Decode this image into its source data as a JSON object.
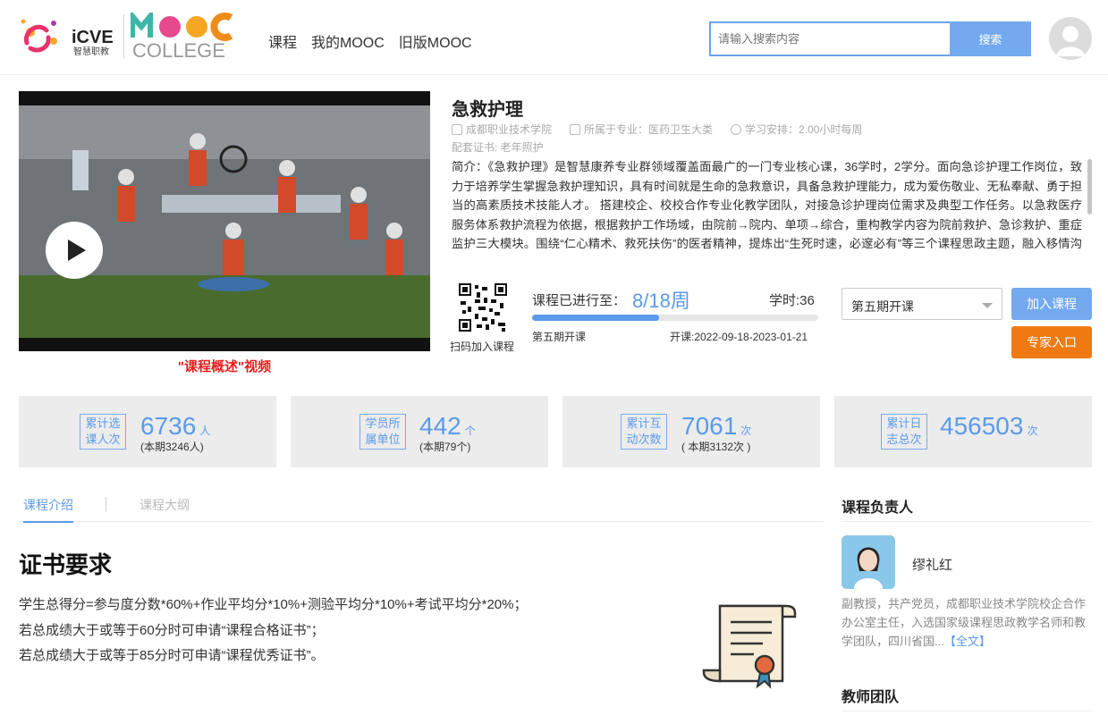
{
  "header": {
    "logo_icve_text": "iCVE",
    "logo_icve_sub": "智慧职教",
    "logo_mooc_text": "MOOC",
    "logo_college_text": "COLLEGE",
    "nav": [
      "课程",
      "我的MOOC",
      "旧版MOOC"
    ],
    "search_placeholder": "请输入搜索内容",
    "search_button": "搜索"
  },
  "video": {
    "caption": "\"课程概述\"视频"
  },
  "course": {
    "title": "急救护理",
    "school": "成都职业技术学院",
    "major": "所属于专业：医药卫生大类",
    "schedule": "学习安排：2.00小时每周",
    "certificate": "配套证书: 老年照护",
    "intro": "简介：《急救护理》是智慧康养专业群领域覆盖面最广的一门专业核心课，36学时，2学分。面向急诊护理工作岗位，致力于培养学生掌握急救护理知识，具有时间就是生命的急救意识，具备急救护理能力，成为爱伤敬业、无私奉献、勇于担当的高素质技术技能人才。 搭建校企、校校合作专业化教学团队，对接急诊护理岗位需求及典型工作任务。以急救医疗服务体系救护流程为依据，根据救护工作场域，由院前→院内、单项→综合，重构教学内容为院前救护、急诊救护、重症监护三大模块。围绕“仁心精术、救死扶伤”的医者精神，提炼出“生死时速，必邃必有”等三个课程思政主题，融入移情沟通、爱伤敬业等思政元素，通过线上线下、课内课外结合，将思政元素基因式融入。"
  },
  "progress": {
    "qr_label": "扫码加入课程",
    "label": "课程已进行至：",
    "value": "8/18周",
    "fraction": 0.444,
    "hours": "学时:36",
    "term": "第五期开课",
    "dates": "开课:2022-09-18-2023-01-21"
  },
  "actions": {
    "term_select": "第五期开课",
    "join": "加入课程",
    "expert": "专家入口"
  },
  "stats": [
    {
      "badge1": "累计选",
      "badge2": "课人次",
      "num": "6736",
      "unit": "人",
      "sub": "(本期3246人)"
    },
    {
      "badge1": "学员所",
      "badge2": "属单位",
      "num": "442",
      "unit": "个",
      "sub": "(本期79个)"
    },
    {
      "badge1": "累计互",
      "badge2": "动次数",
      "num": "7061",
      "unit": "次",
      "sub": "( 本期3132次 )"
    },
    {
      "badge1": "累计日",
      "badge2": "志总次",
      "num": "456503",
      "unit": "次",
      "sub": ""
    }
  ],
  "tabs": {
    "intro": "课程介绍",
    "outline": "课程大纲"
  },
  "content": {
    "heading": "证书要求",
    "lines": [
      "学生总得分=参与度分数*60%+作业平均分*10%+测验平均分*10%+考试平均分*20%；",
      "若总成绩大于或等于60分时可申请“课程合格证书”；",
      "若总成绩大于或等于85分时可申请“课程优秀证书”。"
    ]
  },
  "side": {
    "leader_title": "课程负责人",
    "teacher_name": "缪礼红",
    "teacher_desc": "副教授，共产党员，成都职业技术学院校企合作办公室主任，入选国家级课程思政教学名师和教学团队，四川省国...",
    "full_link": "【全文】",
    "team_title": "教师团队"
  }
}
